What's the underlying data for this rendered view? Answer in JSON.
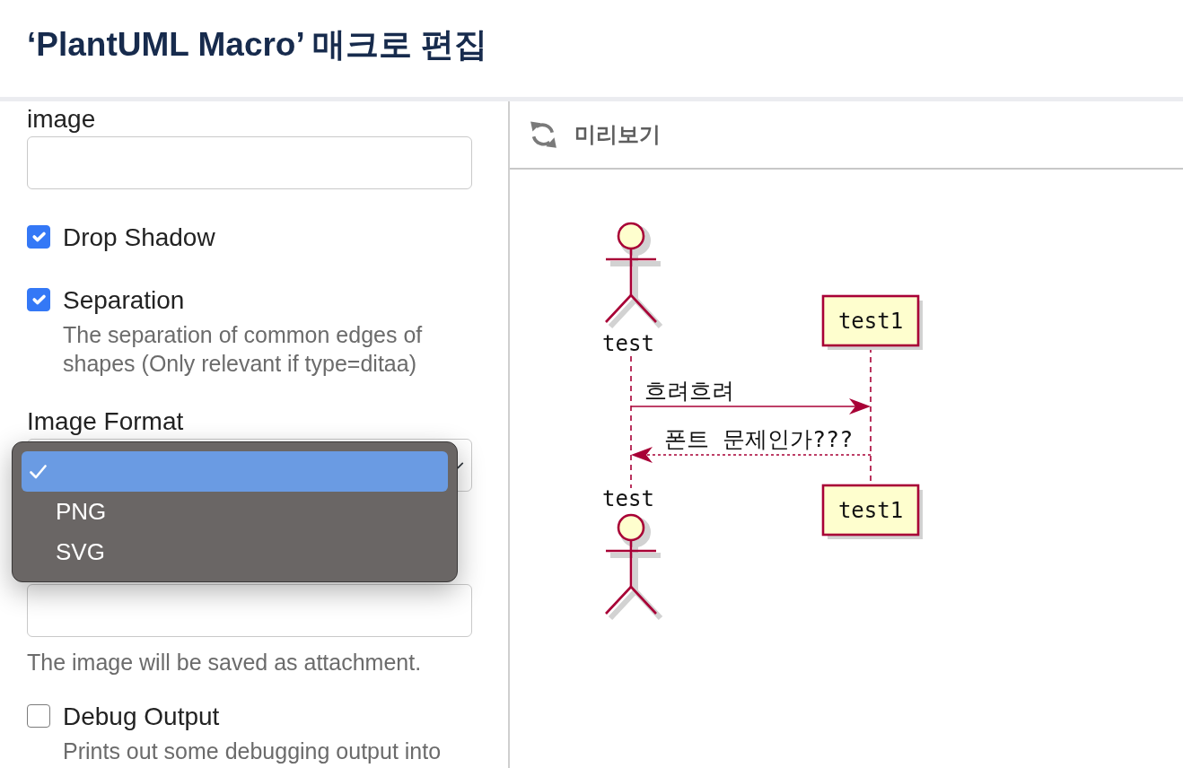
{
  "dialog": {
    "title": "‘PlantUML Macro’ 매크로 편집"
  },
  "form": {
    "fields": [
      {
        "kind": "text",
        "label": "image"
      },
      {
        "kind": "checkbox",
        "label": "Drop Shadow",
        "checked": true
      },
      {
        "kind": "checkbox",
        "label": "Separation",
        "checked": true,
        "description": "The separation of common edges of shapes (Only relevant if type=ditaa)"
      },
      {
        "kind": "select",
        "label": "Image Format",
        "expanded": true,
        "options": [
          {
            "selected": true
          },
          {
            "label": "PNG",
            "selected": false
          },
          {
            "label": "SVG",
            "selected": false
          }
        ]
      },
      {
        "kind": "text",
        "help": "The image will be saved as attachment."
      },
      {
        "kind": "checkbox",
        "label": "Debug Output",
        "checked": false,
        "description": "Prints out some debugging output into"
      }
    ]
  },
  "preview": {
    "title": "미리보기",
    "diagram": {
      "participants": [
        {
          "kind": "actor",
          "top_label": "test",
          "bottom_label": "test"
        },
        {
          "kind": "participant",
          "top_label": "test1",
          "bottom_label": "test1"
        }
      ],
      "messages": [
        {
          "kind": "call",
          "text": "흐려흐려"
        },
        {
          "kind": "return",
          "text": "폰트 문제인가???"
        }
      ]
    }
  }
}
